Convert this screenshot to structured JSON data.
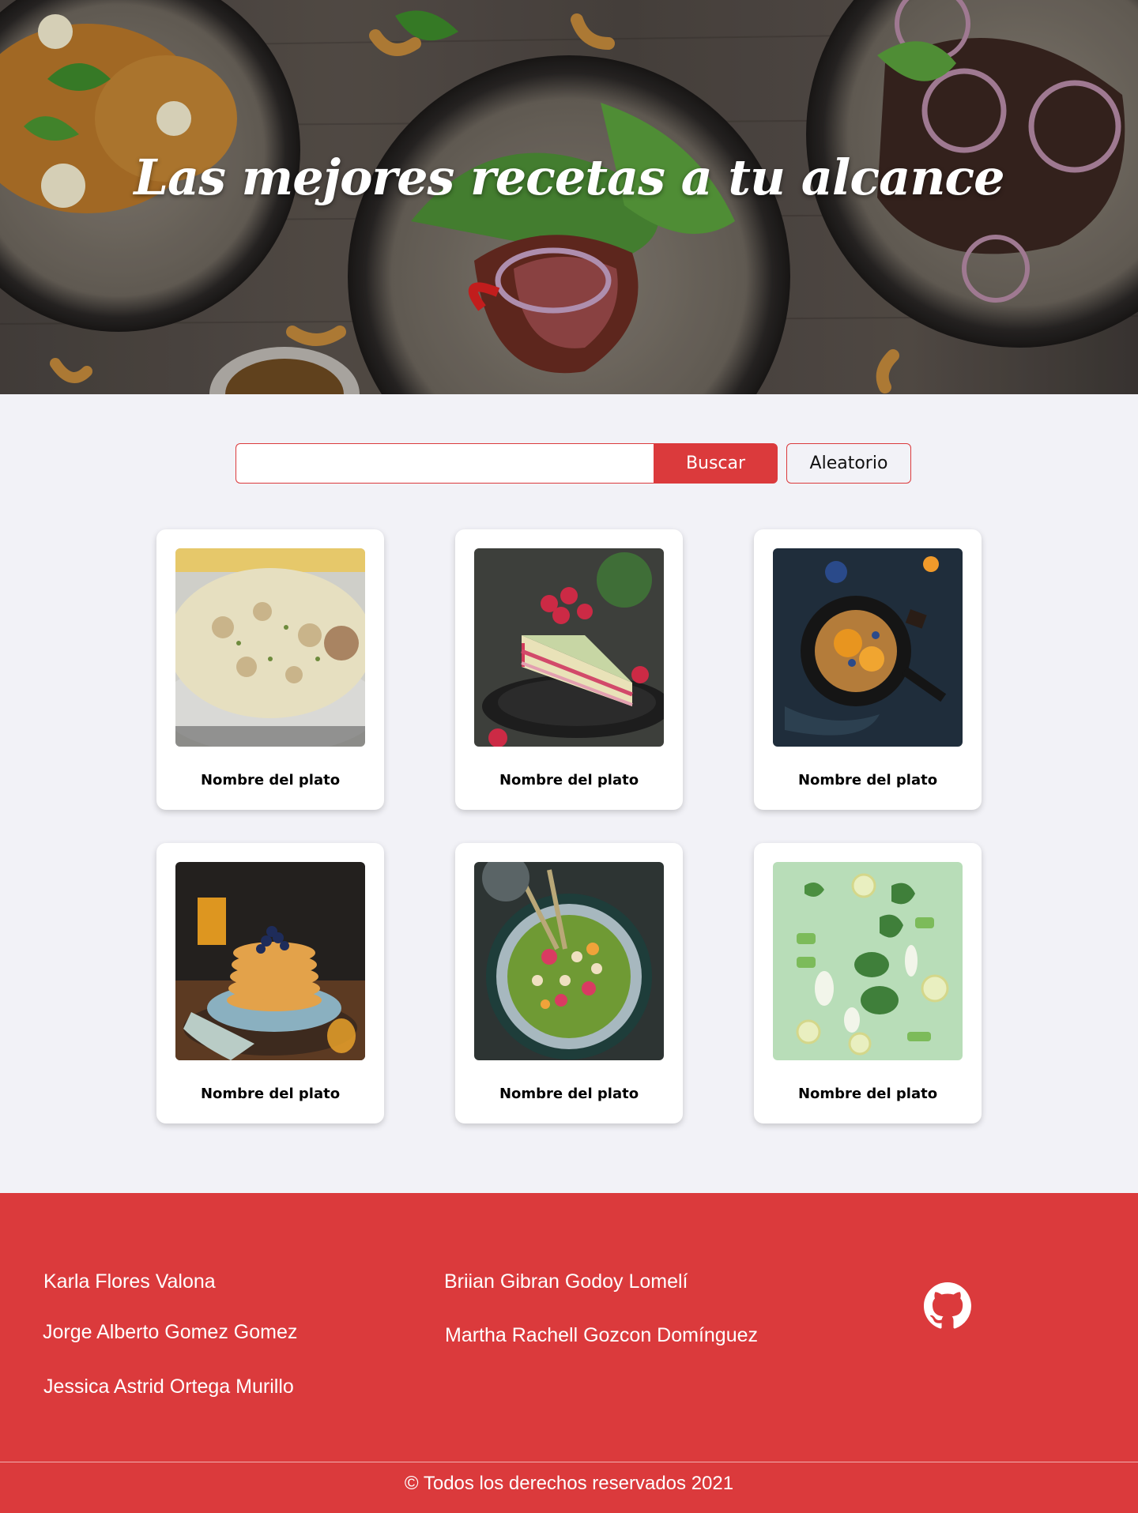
{
  "hero": {
    "title": "Las mejores recetas a tu alcance",
    "image": "grilled-steak-and-salad-plates-photo"
  },
  "search": {
    "value": "",
    "placeholder": "",
    "button_label": "Buscar",
    "random_label": "Aleatorio"
  },
  "recipes": [
    {
      "name": "Nombre del plato",
      "image": "potato-salad-photo"
    },
    {
      "name": "Nombre del plato",
      "image": "raspberry-cake-photo"
    },
    {
      "name": "Nombre del plato",
      "image": "pancake-skillet-photo"
    },
    {
      "name": "Nombre del plato",
      "image": "blueberry-pancake-stack-photo"
    },
    {
      "name": "Nombre del plato",
      "image": "salad-bowl-photo"
    },
    {
      "name": "Nombre del plato",
      "image": "green-vegetables-flatlay-photo"
    }
  ],
  "footer": {
    "authors_left": [
      "Karla Flores Valona",
      "Jorge Alberto Gomez Gomez",
      "Jessica Astrid Ortega Murillo"
    ],
    "authors_right": [
      "Briian Gibran Godoy Lomelí",
      "Martha Rachell Gozcon Domínguez"
    ],
    "github_icon": "github-icon",
    "copyright": "© Todos los derechos reservados 2021"
  },
  "colors": {
    "accent": "#db3a3c",
    "background": "#f2f2f7"
  }
}
